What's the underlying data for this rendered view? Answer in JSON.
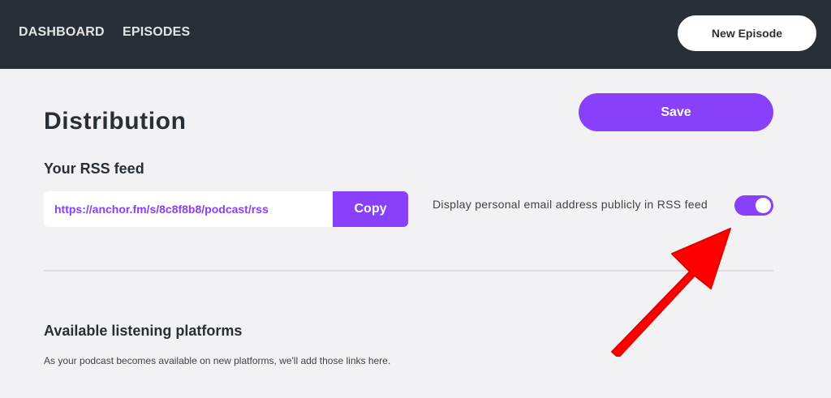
{
  "nav": {
    "dashboard": "DASHBOARD",
    "episodes": "EPISODES",
    "new_episode": "New Episode"
  },
  "page": {
    "title": "Distribution",
    "save_label": "Save"
  },
  "rss": {
    "heading": "Your RSS feed",
    "url": "https://anchor.fm/s/8c8f8b8/podcast/rss",
    "copy_label": "Copy",
    "email_toggle_label": "Display personal email address publicly in RSS feed",
    "email_toggle_on": true
  },
  "platforms": {
    "heading": "Available listening platforms",
    "description": "As your podcast becomes available on new platforms, we'll add those links here."
  },
  "colors": {
    "accent": "#8940fa",
    "topbar": "#292f36",
    "background": "#f2f1f3",
    "annotation_arrow": "#ff0000"
  }
}
